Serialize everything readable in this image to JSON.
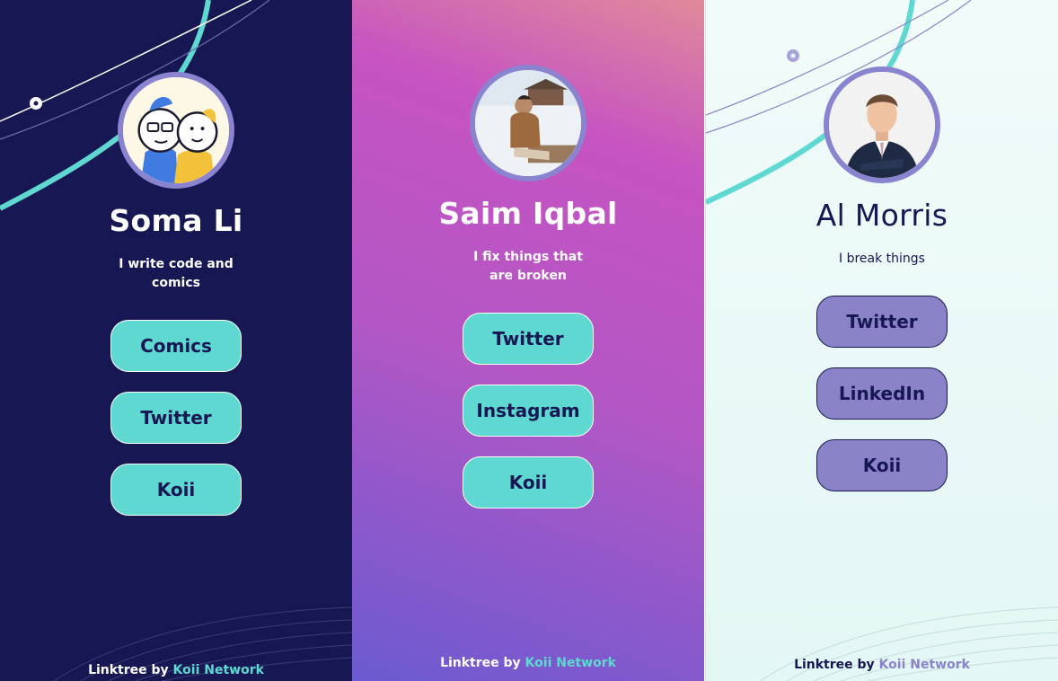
{
  "colors": {
    "navy": "#171753",
    "teal": "#5ed8d0",
    "lavender": "#8a83c8",
    "white": "#ffffff"
  },
  "profiles": [
    {
      "name": "Soma Li",
      "bio": "I write code and comics",
      "avatar_icon": "cartoon-avatar-icon",
      "links": [
        {
          "label": "Comics"
        },
        {
          "label": "Twitter"
        },
        {
          "label": "Koii"
        }
      ],
      "footer": {
        "prefix": "Linktree by",
        "link": "Koii Network"
      }
    },
    {
      "name": "Saim Iqbal",
      "bio": "I fix things that are broken",
      "avatar_icon": "photo-avatar-icon",
      "links": [
        {
          "label": "Twitter"
        },
        {
          "label": "Instagram"
        },
        {
          "label": "Koii"
        }
      ],
      "footer": {
        "prefix": "Linktree by",
        "link": "Koii Network"
      }
    },
    {
      "name": "Al Morris",
      "bio": "I break things",
      "avatar_icon": "photo-avatar-icon",
      "links": [
        {
          "label": "Twitter"
        },
        {
          "label": "LinkedIn"
        },
        {
          "label": "Koii"
        }
      ],
      "footer": {
        "prefix": "Linktree by",
        "link": "Koii Network"
      }
    }
  ]
}
